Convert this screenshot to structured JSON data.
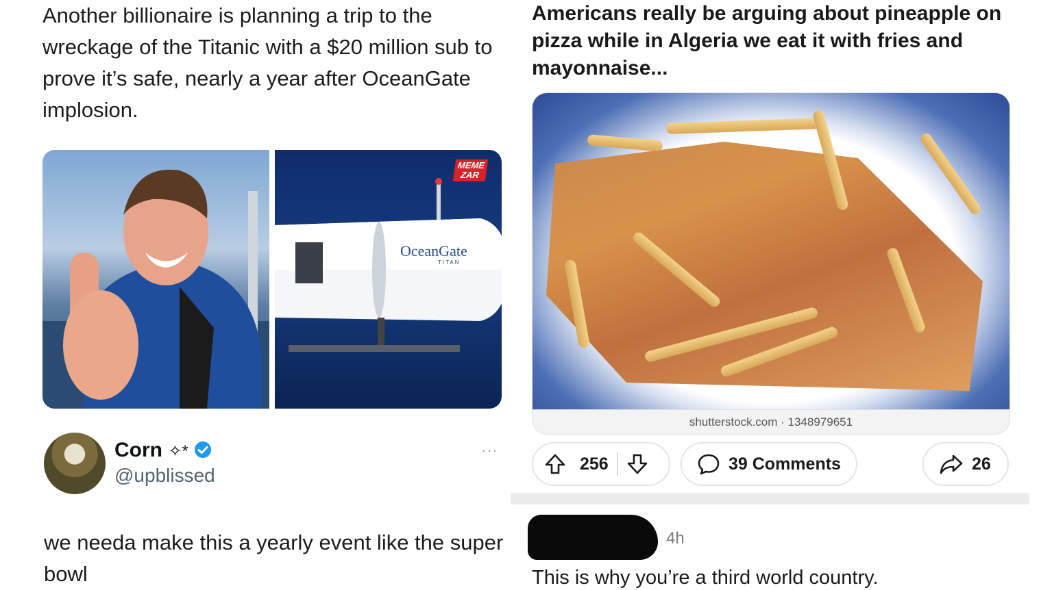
{
  "tweet": {
    "text": "Another billionaire is planning a trip to the wreckage of the Titanic with a $20 million sub to prove it’s safe, nearly a year after OceanGate implosion.",
    "media": {
      "watermark_line1": "MEME",
      "watermark_line2": "ZAR",
      "sub_brand": "OceanGate",
      "sub_model": "TITAN"
    }
  },
  "reply": {
    "display_name": "Corn",
    "name_decoration": "✧*",
    "verified_color": "#1d9bf0",
    "handle": "@upblissed",
    "more_label": "···",
    "text": "we needa make this a yearly event like the super bowl"
  },
  "reddit_post": {
    "title": "Americans really be arguing about pineapple on pizza while in Algeria we eat it with fries and mayonnaise...",
    "image_caption": "shutterstock.com · 1348979651",
    "upvotes": "256",
    "comments_label": "39 Comments",
    "shares": "26"
  },
  "comment": {
    "time": "4h",
    "text": "This is why you’re a third world country."
  }
}
